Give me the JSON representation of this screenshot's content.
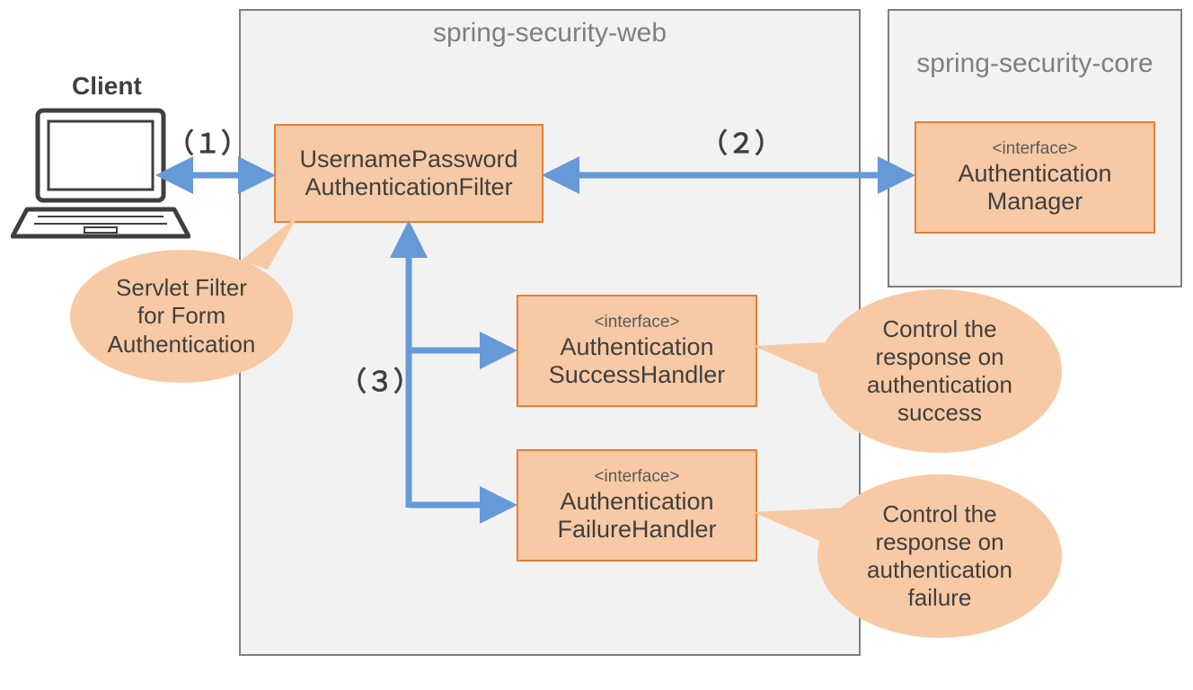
{
  "client_label": "Client",
  "modules": {
    "web": {
      "title": "spring-security-web"
    },
    "core": {
      "title": "spring-security-core"
    }
  },
  "nodes": {
    "filter": {
      "line1": "UsernamePassword",
      "line2": "AuthenticationFilter"
    },
    "manager": {
      "stereo": "<interface>",
      "line1": "Authentication",
      "line2": "Manager"
    },
    "success": {
      "stereo": "<interface>",
      "line1": "Authentication",
      "line2": "SuccessHandler"
    },
    "failure": {
      "stereo": "<interface>",
      "line1": "Authentication",
      "line2": "FailureHandler"
    }
  },
  "callouts": {
    "filter_note": "Servlet Filter\nfor Form\nAuthentication",
    "success_note": "Control the\nresponse on\nauthentication\nsuccess",
    "failure_note": "Control the\nresponse on\nauthentication\nfailure"
  },
  "steps": {
    "one": "（１）",
    "two": "（２）",
    "three": "（３）"
  },
  "colors": {
    "arrow": "#6699d8",
    "node_fill": "#f7caa5",
    "node_border": "#ed7d31",
    "module_border": "#7f7f7f",
    "module_fill": "#f2f2f2"
  }
}
